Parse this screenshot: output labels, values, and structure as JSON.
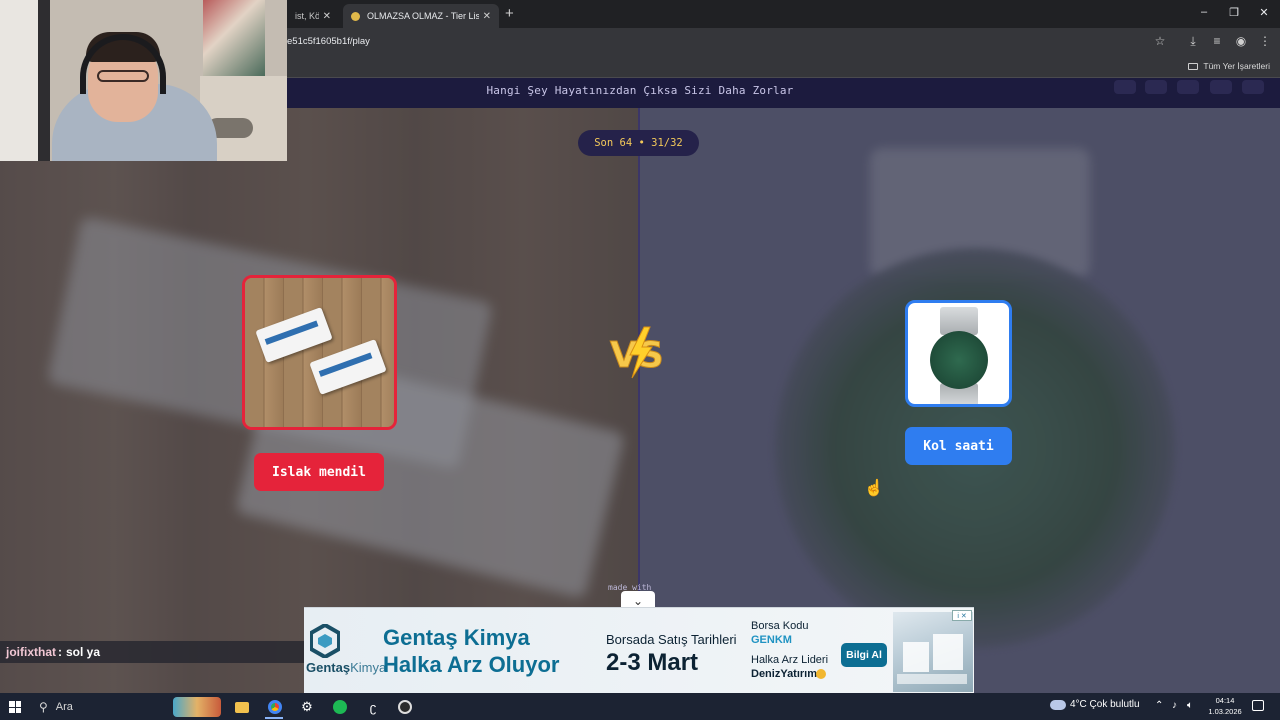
{
  "browser": {
    "tabs": [
      {
        "title": "ist, Kör S",
        "active": false
      },
      {
        "title": "OLMAZSA OLMAZ - Tier List, K",
        "active": true
      }
    ],
    "new_tab_symbol": "+",
    "tab_close_symbol": "✕",
    "url": "e51c5f1605b1f/play",
    "bookmarks_label": "Tüm Yer İşaretleri",
    "window_controls": [
      "minimize",
      "restore",
      "close"
    ]
  },
  "page": {
    "title": "Hangi Şey Hayatınızdan Çıksa Sizi Daha Zorlar",
    "round_counter": "Son 64 • 31/32",
    "left_option": {
      "label": "Islak mendil",
      "color": "#e5233a"
    },
    "right_option": {
      "label": "Kol saati",
      "color": "#2f7df0"
    },
    "vs_text": "VS",
    "footer_text": "made with",
    "collapse_symbol": "⌄"
  },
  "ad": {
    "brand": "Gentaş",
    "brand_suffix": "Kimya",
    "headline_line1": "Gentaş Kimya",
    "headline_line2": "Halka Arz Oluyor",
    "date_label": "Borsada Satış Tarihleri",
    "date_value": "2-3 Mart",
    "code_label": "Borsa Kodu",
    "code_value": "GENKM",
    "leader_label": "Halka Arz Lideri",
    "broker": "DenizYatırım",
    "cta": "Bilgi Al",
    "info_badge": "i ✕"
  },
  "chat": {
    "user": "joifixthat",
    "separator": ":",
    "message": "sol ya"
  },
  "taskbar": {
    "search_placeholder": "Ara",
    "weather": "4°C  Çok bulutlu",
    "time": "04:14",
    "date": "1.03.2026"
  }
}
